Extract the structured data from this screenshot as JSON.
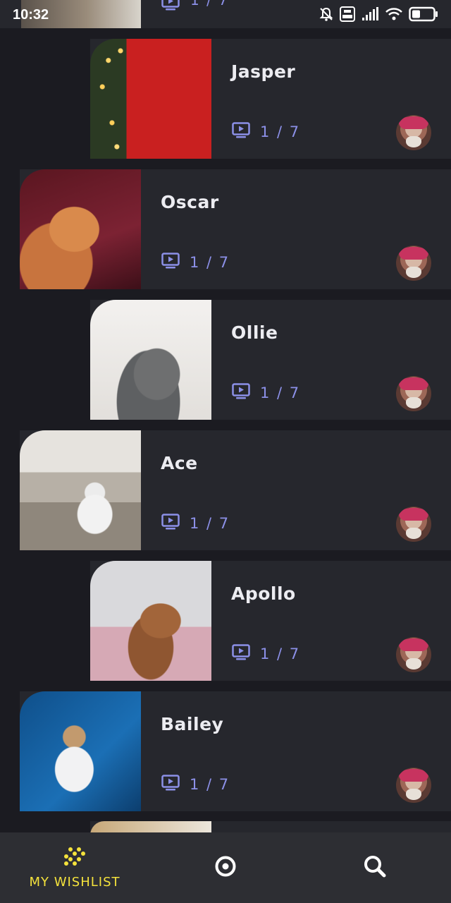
{
  "status_bar": {
    "time": "10:32"
  },
  "partial_top": {
    "count": "1 / 7"
  },
  "cards": [
    {
      "name": "Jasper",
      "count": "1 / 7"
    },
    {
      "name": "Oscar",
      "count": "1 / 7"
    },
    {
      "name": "Ollie",
      "count": "1 / 7"
    },
    {
      "name": "Ace",
      "count": "1 / 7"
    },
    {
      "name": "Apollo",
      "count": "1 / 7"
    },
    {
      "name": "Bailey",
      "count": "1 / 7"
    }
  ],
  "bottom_nav": {
    "wishlist_label": "MY WISHLIST",
    "active": "wishlist",
    "accent_color": "#f4e23c"
  },
  "colors": {
    "background": "#1b1b21",
    "card": "#26272d",
    "count_accent": "#8c90e8"
  },
  "icons": {
    "meta": "play-screen-icon",
    "wishlist": "dots-grid-icon",
    "target": "target-icon",
    "search": "search-icon"
  }
}
